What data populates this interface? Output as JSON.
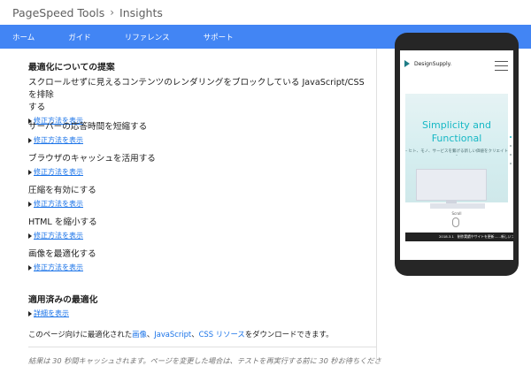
{
  "breadcrumb": {
    "root": "PageSpeed Tools",
    "separator": "›",
    "current": "Insights"
  },
  "nav": {
    "items": [
      "ホーム",
      "ガイド",
      "リファレンス",
      "サポート"
    ]
  },
  "suggestions": {
    "heading": "最適化についての提案",
    "link_label": "修正方法を表示",
    "rules": [
      {
        "title": "スクロールせずに見えるコンテンツのレンダリングをブロックしている JavaScript/CSS を排除\nする"
      },
      {
        "title": "サーバーの応答時間を短縮する"
      },
      {
        "title": "ブラウザのキャッシュを活用する"
      },
      {
        "title": "圧縮を有効にする"
      },
      {
        "title": "HTML を縮小する"
      },
      {
        "title": "画像を最適化する"
      }
    ]
  },
  "applied": {
    "heading": "適用済みの最適化",
    "details_label": "詳細を表示"
  },
  "download": {
    "prefix": "このページ向けに最適化された",
    "images": "画像",
    "sep1": "、",
    "js": "JavaScript",
    "sep2": "、",
    "css": "CSS リソース",
    "suffix": "をダウンロードできます。"
  },
  "cache_note": "結果は 30 秒間キャッシュされます。ページを変更した場合は、テストを再実行する前に 30 秒お待ちくださ",
  "preview": {
    "logo": "DesignSupply.",
    "hero_line1": "Simplicity and",
    "hero_line2": "Functional",
    "hero_sub": "– ヒト、モノ、サービスを繋げる新しい価値をクリエイト –",
    "scroll_label": "Scroll",
    "news": "2018.3.1　制作実績やサイトを更新……新しいフルード",
    "accent_color": "#17b8c5"
  },
  "colors": {
    "nav_bg": "#4285f4",
    "link": "#1a73e8"
  }
}
